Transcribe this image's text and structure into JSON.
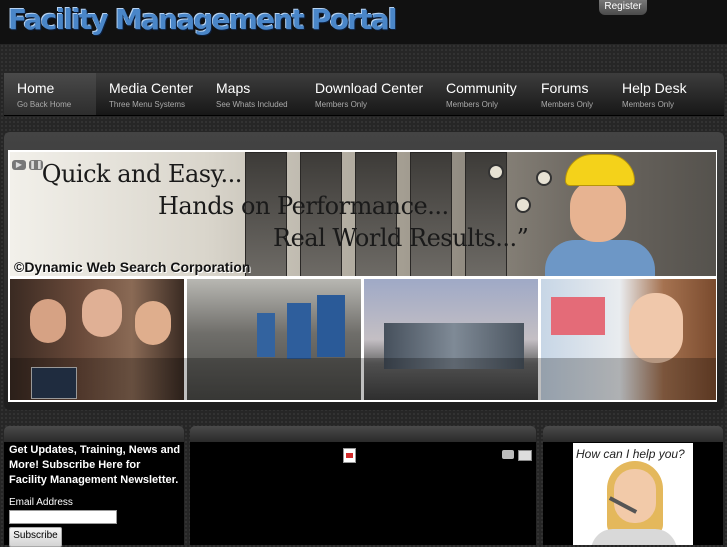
{
  "header": {
    "site_title": "Facility Management Portal",
    "register_label": "Register"
  },
  "nav": [
    {
      "label": "Home",
      "sub": "Go Back Home",
      "active": true
    },
    {
      "label": "Media Center",
      "sub": "Three Menu Systems"
    },
    {
      "label": "Maps",
      "sub": "See Whats Included"
    },
    {
      "label": "Download Center",
      "sub": "Members Only"
    },
    {
      "label": "Community",
      "sub": "Members Only"
    },
    {
      "label": "Forums",
      "sub": "Members Only"
    },
    {
      "label": "Help Desk",
      "sub": "Members Only"
    }
  ],
  "slideshow": {
    "quote_line1": "“Quick and Easy...",
    "quote_line2": "Hands on Performance...",
    "quote_line3": "Real World Results...”",
    "copyright": "©Dynamic Web Search Corporation",
    "play_icon": "play-icon",
    "pause_icon": "pause-icon"
  },
  "newsletter": {
    "text": "Get Updates, Training, News and More! Subscribe Here for Facility Management Newsletter.",
    "email_label": "Email Address",
    "email_value": "",
    "subscribe_label": "Subscribe"
  },
  "article_icons": [
    "pdf-icon",
    "print-icon",
    "email-icon"
  ],
  "help": {
    "text": "How can I help you?"
  },
  "colors": {
    "title_blue": "#4a86c8",
    "background": "#262626",
    "hard_hat": "#f4d21a"
  }
}
